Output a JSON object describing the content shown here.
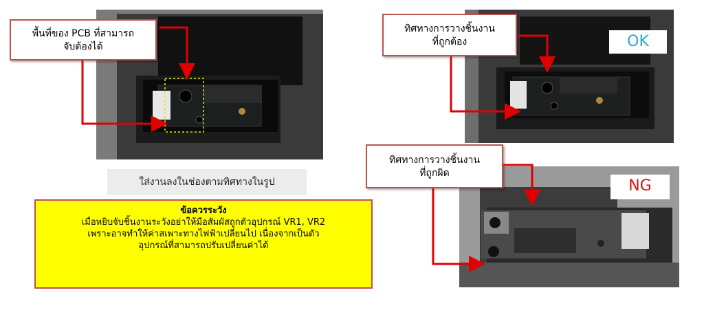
{
  "left_panel": {
    "callout_line1": "พื้นที่ของ PCB ที่สามารถ",
    "callout_line2": "จับต้องได้",
    "caption": "ใส่งานลงในช่องตามทิศทางในรูป"
  },
  "warning": {
    "title": "ข้อควรระวัง",
    "line1": "เมื่อหยิบจับชิ้นงานระวังอย่าให้มือสัมผัสถูกตัวอุปกรณ์ VR1, VR2",
    "line2": "เพราะอาจทำให้ค่าสเพาะทางไฟฟ้าเปลี่ยนไป เนื่องจากเป็นตัว",
    "line3": "อุปกรณ์ที่สามารถปรับเปลี่ยนค่าได้"
  },
  "ok_panel": {
    "callout_line1": "ทิศทางการวางชิ้นงาน",
    "callout_line2": "ที่ถูกต้อง",
    "tag": "OK",
    "tag_color": "#2aa8d6"
  },
  "ng_panel": {
    "callout_line1": "ทิศทางการวางชิ้นงาน",
    "callout_line2": "ที่ถูกผิด",
    "tag": "NG",
    "tag_color": "#e01010"
  },
  "colors": {
    "arrow": "#e00000",
    "callout_border": "#c0504d",
    "warning_bg": "#ffff00"
  }
}
